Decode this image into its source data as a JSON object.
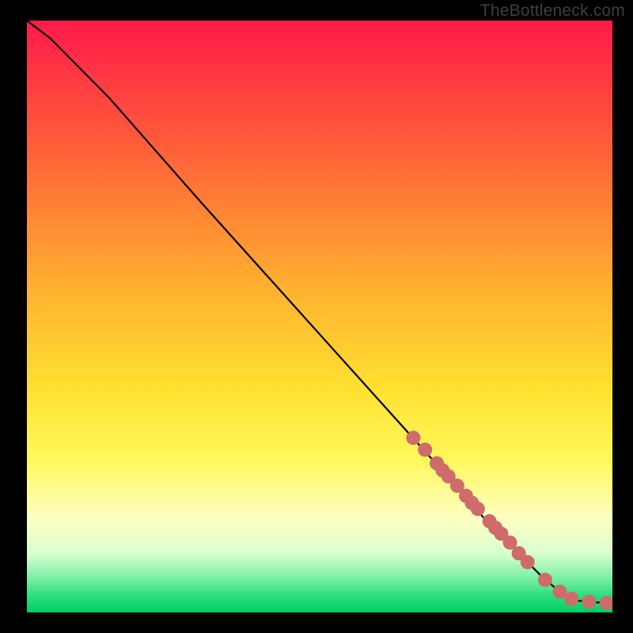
{
  "watermark": "TheBottleneck.com",
  "chart_data": {
    "type": "line",
    "title": "",
    "xlabel": "",
    "ylabel": "",
    "xlim": [
      0,
      100
    ],
    "ylim": [
      0,
      100
    ],
    "gradient_stops": [
      {
        "offset": 0,
        "color": "#ff1a4b"
      },
      {
        "offset": 20,
        "color": "#ff5a3a"
      },
      {
        "offset": 45,
        "color": "#ffb030"
      },
      {
        "offset": 62,
        "color": "#ffe030"
      },
      {
        "offset": 74,
        "color": "#fff85a"
      },
      {
        "offset": 84,
        "color": "#feffc0"
      },
      {
        "offset": 90,
        "color": "#d9ffd0"
      },
      {
        "offset": 94,
        "color": "#7ff0a8"
      },
      {
        "offset": 97,
        "color": "#30e080"
      },
      {
        "offset": 100,
        "color": "#00d060"
      }
    ],
    "curve": {
      "x": [
        0,
        4,
        8,
        14,
        22,
        30,
        40,
        50,
        60,
        70,
        78,
        84,
        88,
        91,
        94,
        97,
        100
      ],
      "y": [
        100,
        97,
        93,
        87,
        78,
        69,
        58,
        47,
        36,
        25,
        16,
        10,
        6,
        3.5,
        2,
        1.7,
        1.6
      ]
    },
    "markers": {
      "x": [
        66,
        68,
        70,
        71,
        72,
        73.5,
        75,
        76,
        77,
        79,
        80,
        81,
        82.5,
        84,
        85.5,
        88.5,
        91,
        93,
        96,
        99
      ],
      "y": [
        29.5,
        27.5,
        25.2,
        24.0,
        23.0,
        21.4,
        19.7,
        18.5,
        17.5,
        15.4,
        14.3,
        13.3,
        11.8,
        10.0,
        8.5,
        5.5,
        3.5,
        2.3,
        1.8,
        1.6
      ]
    }
  }
}
